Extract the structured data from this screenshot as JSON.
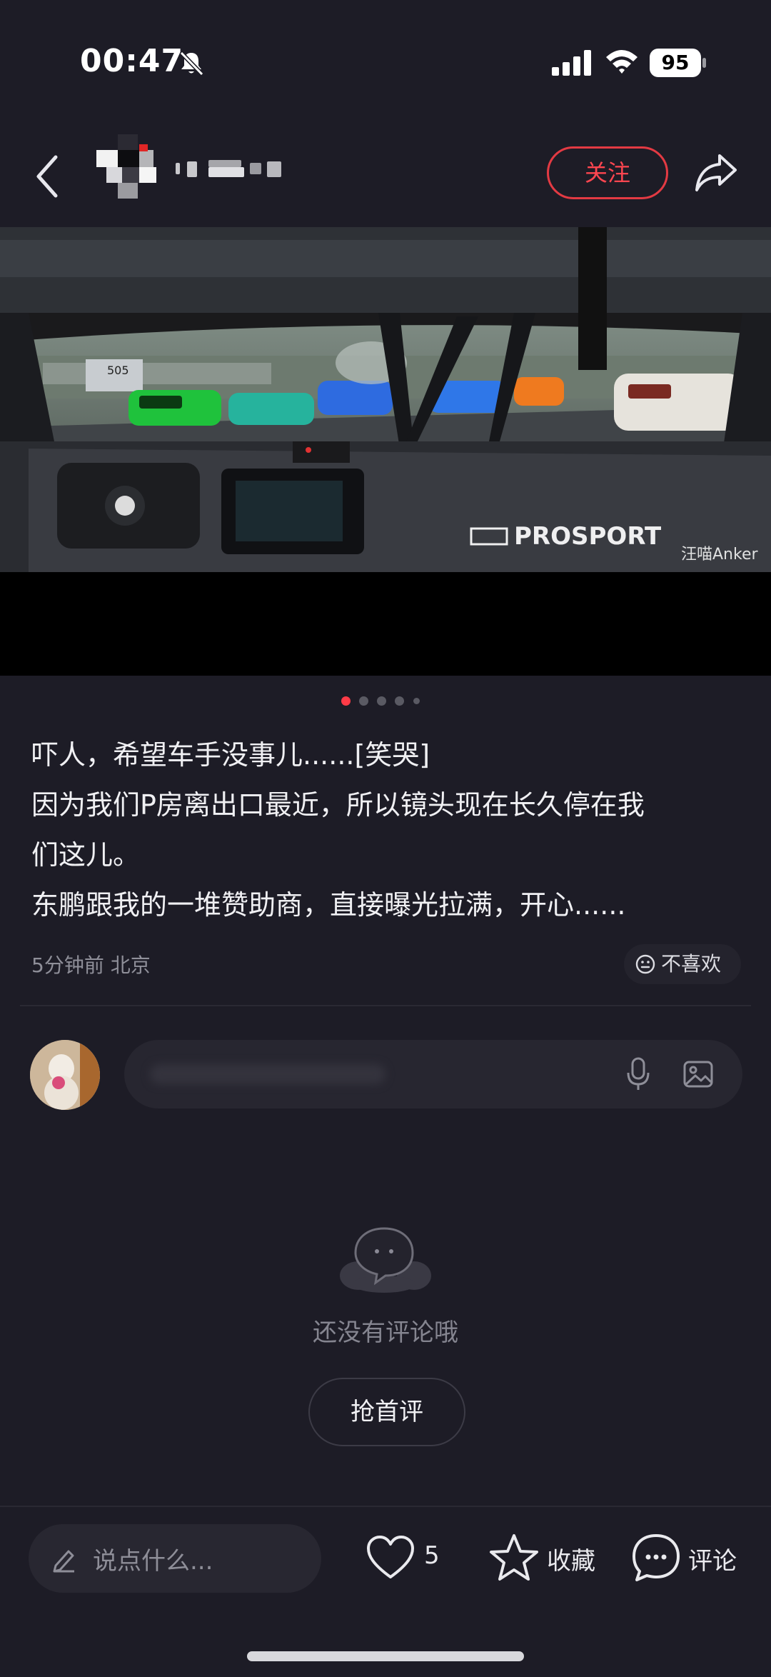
{
  "status_bar": {
    "time": "00:47",
    "battery": "95"
  },
  "header": {
    "follow_label": "关注"
  },
  "media": {
    "watermark": "汪喵Anker",
    "overlay_text": "505"
  },
  "carousel": {
    "current_page": 1,
    "pages": 5
  },
  "post": {
    "lines": [
      "吓人，希望车手没事儿......[笑哭]",
      "因为我们P房离出口最近，所以镜头现在长久停在我",
      "们这儿。",
      "东鹏跟我的一堆赞助商，直接曝光拉满，开心......"
    ],
    "meta": "5分钟前 北京",
    "dislike_label": "不喜欢"
  },
  "comments": {
    "empty_text": "还没有评论哦",
    "first_button": "抢首评"
  },
  "bottom_bar": {
    "input_placeholder": "说点什么...",
    "like_count": "5",
    "favorite_label": "收藏",
    "comment_label": "评论"
  },
  "colors": {
    "accent": "#ff3b47",
    "background": "#1d1c26"
  }
}
